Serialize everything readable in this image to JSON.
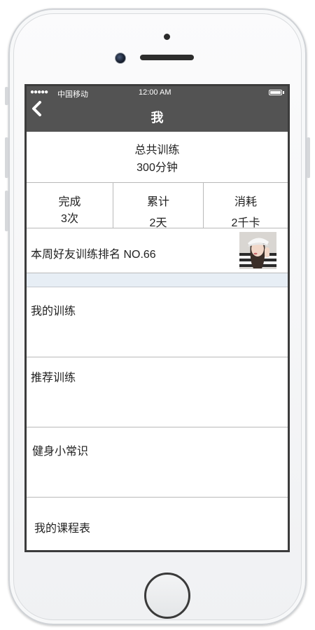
{
  "status_bar": {
    "signal": "●●●●●",
    "carrier": "中国移动",
    "time": "12:00 AM"
  },
  "header": {
    "title": "我",
    "back_icon": "chevron-left-icon"
  },
  "total_training": {
    "label": "总共训练",
    "value": "300分钟"
  },
  "stats": [
    {
      "label": "完成",
      "value": "3次"
    },
    {
      "label": "累计",
      "value": "2天"
    },
    {
      "label": "消耗",
      "value": "2千卡"
    }
  ],
  "ranking": {
    "text": "本周好友训练排名  NO.66"
  },
  "menu": [
    {
      "label": "我的训练"
    },
    {
      "label": "推荐训练"
    },
    {
      "label": "健身小常识"
    },
    {
      "label": "我的课程表"
    }
  ],
  "colors": {
    "topbar": "#535353",
    "divider": "#e7eef5",
    "frame": "#3c3c3c"
  }
}
